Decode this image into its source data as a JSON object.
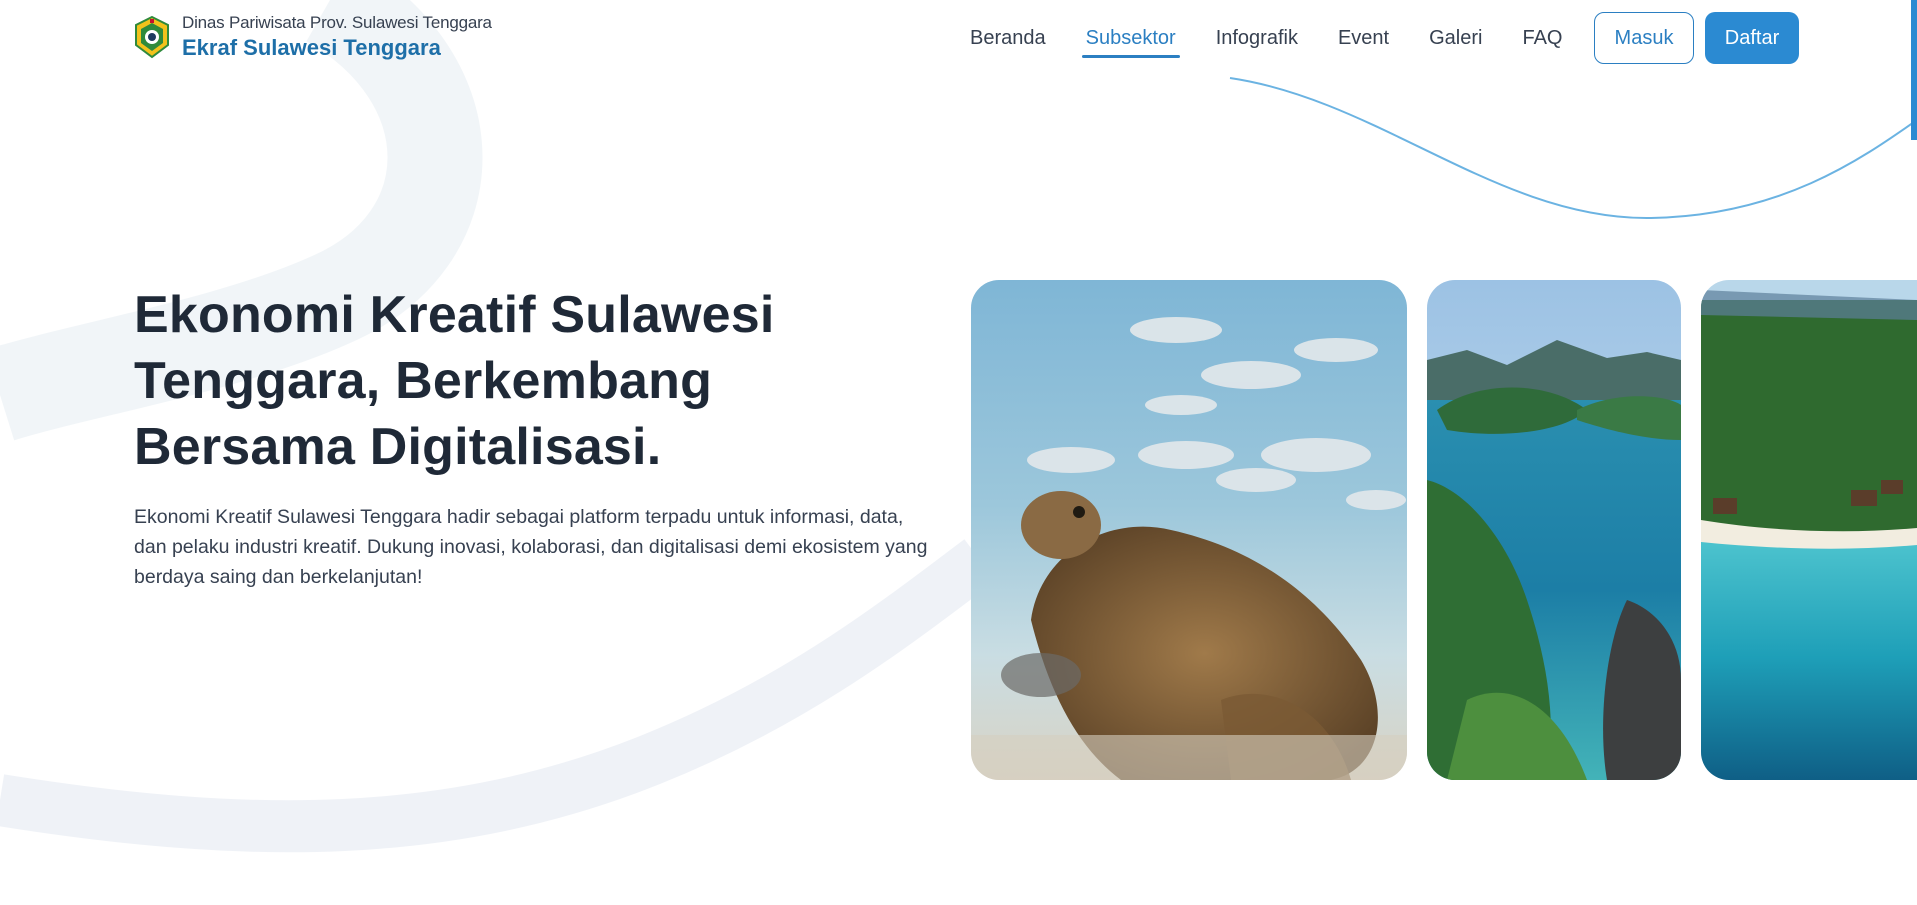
{
  "header": {
    "brand": {
      "subtitle": "Dinas Pariwisata Prov. Sulawesi Tenggara",
      "title": "Ekraf Sulawesi Tenggara",
      "logo_icon": "provincial-emblem-icon"
    },
    "nav": [
      {
        "label": "Beranda",
        "active": false
      },
      {
        "label": "Subsektor",
        "active": true
      },
      {
        "label": "Infografik",
        "active": false
      },
      {
        "label": "Event",
        "active": false
      },
      {
        "label": "Galeri",
        "active": false
      },
      {
        "label": "FAQ",
        "active": false
      }
    ],
    "login_label": "Masuk",
    "register_label": "Daftar"
  },
  "hero": {
    "title": "Ekonomi Kreatif Sulawesi Tenggara, Berkembang Bersama Digitalisasi.",
    "description": "Ekonomi Kreatif Sulawesi Tenggara hadir sebagai platform terpadu untuk informasi, data, dan pelaku industri kreatif. Dukung inovasi, kolaborasi, dan digitalisasi demi ekosistem yang berdaya saing dan berkelanjutan!"
  },
  "gallery": [
    {
      "subject": "sea-turtle-with-fish-underwater"
    },
    {
      "subject": "lagoon-islands-aerial"
    },
    {
      "subject": "beach-resort-coastline"
    }
  ],
  "colors": {
    "accent": "#2b7fc2",
    "button_primary": "#2b8ad2",
    "brand_title": "#1e6fa8",
    "heading": "#1f2937",
    "text": "#374151"
  }
}
